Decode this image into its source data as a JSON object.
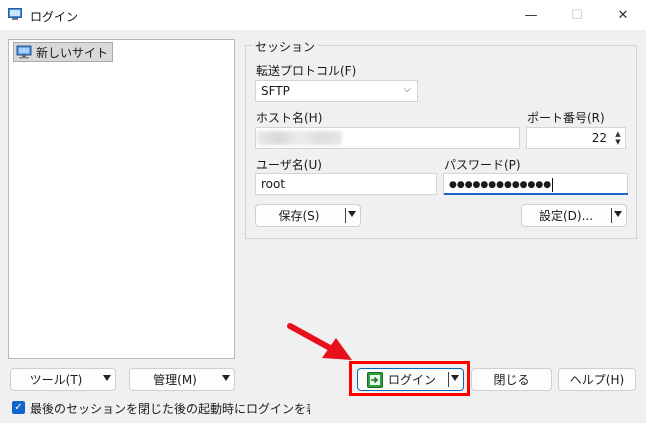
{
  "window": {
    "title": "ログイン",
    "controls": [
      "—",
      "☐",
      "✕"
    ]
  },
  "site_tree": {
    "items": [
      {
        "label": "新しいサイト",
        "icon": "computer-icon"
      }
    ]
  },
  "session": {
    "group_label": "セッション",
    "protocol_label": "転送プロトコル(F)",
    "protocol_value": "SFTP",
    "host_label": "ホスト名(H)",
    "host_value": "",
    "port_label": "ポート番号(R)",
    "port_value": "22",
    "user_label": "ユーザ名(U)",
    "user_value": "root",
    "password_label": "パスワード(P)",
    "password_value": "●●●●●●●●●●●●●",
    "save_button": "保存(S)",
    "settings_button": "設定(D)..."
  },
  "bottom": {
    "tools_button": "ツール(T)",
    "manage_button": "管理(M)",
    "login_button": "ログイン",
    "close_button": "閉じる",
    "help_button": "ヘルプ(H)",
    "show_login_label": "最後のセッションを閉じた後の起動時にログインを表示(S)"
  },
  "colors": {
    "highlight": "#ff0000",
    "arrow": "#e8101a",
    "accent": "#1166cc"
  }
}
